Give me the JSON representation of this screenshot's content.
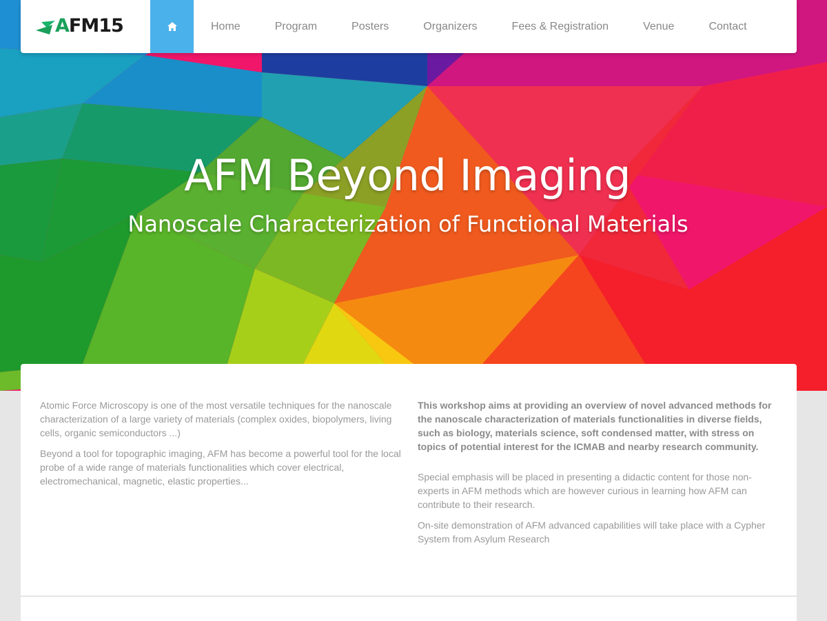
{
  "logo": {
    "text_a": "A",
    "text_rest": "FM15"
  },
  "nav": {
    "home_icon": "home-icon",
    "items": [
      "Home",
      "Program",
      "Posters",
      "Organizers",
      "Fees & Registration",
      "Venue",
      "Contact"
    ]
  },
  "hero": {
    "title": "AFM Beyond Imaging",
    "subtitle": "Nanoscale Characterization of Functional Materials"
  },
  "content": {
    "left": [
      "Atomic Force Microscopy is one of the most versatile techniques for the nanoscale characterization of a large variety of materials (complex oxides, biopolymers, living cells, organic semiconductors ...)",
      "Beyond a tool for topographic imaging, AFM has become a powerful tool for the local probe of a wide range of materials functionalities which cover electrical, electromechanical, magnetic, elastic properties..."
    ],
    "right_bold": "This workshop aims at providing an overview of novel advanced methods for the nanoscale characterization of materials functionalities in diverse fields, such as biology, materials science, soft condensed matter, with stress on topics of potential interest for the ICMAB and nearby research community.",
    "right": [
      "Special emphasis will be placed in presenting a didactic content for those non-experts in AFM methods which are however curious in learning how AFM can contribute to their research.",
      "On-site demonstration of AFM advanced capabilities will take place with a Cypher System from Asylum Research"
    ]
  },
  "colors": {
    "nav_accent": "#4ab1ea",
    "logo_green": "#1aa05a",
    "body_text": "#999999"
  }
}
